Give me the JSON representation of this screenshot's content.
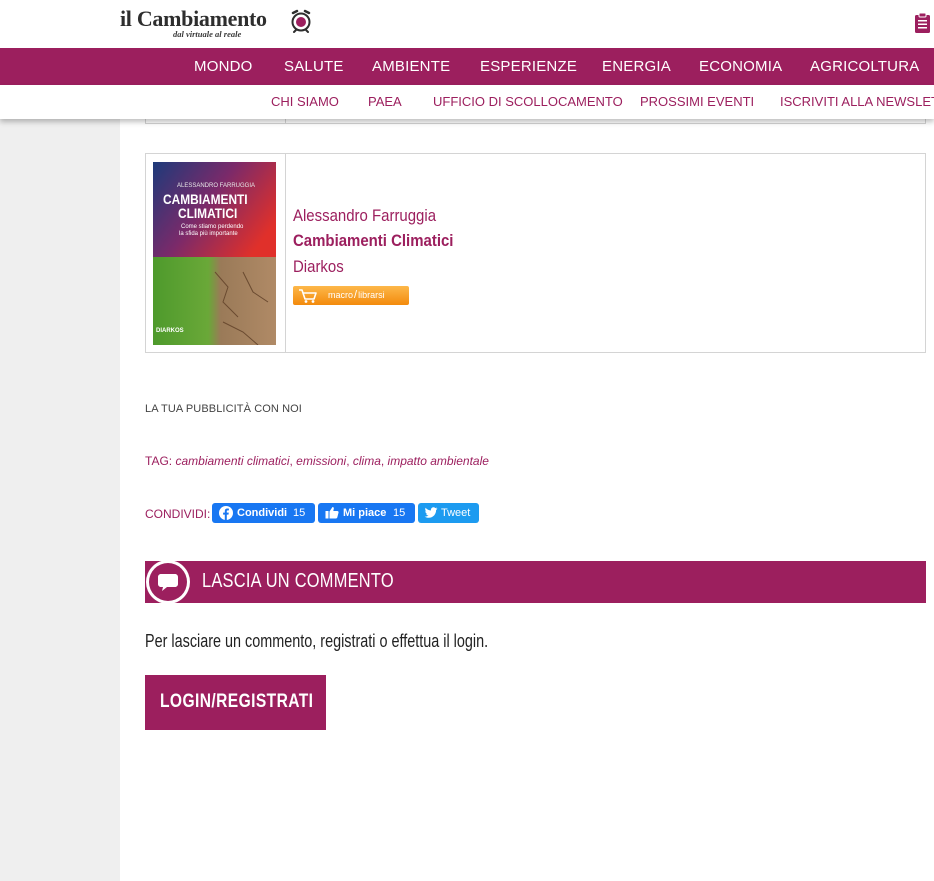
{
  "brand": {
    "name": "il Cambiamento",
    "tagline": "dal virtuale al reale"
  },
  "main_nav": [
    "MONDO",
    "SALUTE",
    "AMBIENTE",
    "ESPERIENZE",
    "ENERGIA",
    "ECONOMIA",
    "AGRICOLTURA"
  ],
  "sub_nav": [
    "CHI SIAMO",
    "PAEA",
    "UFFICIO DI SCOLLOCAMENTO",
    "PROSSIMI EVENTI",
    "ISCRIVITI ALLA NEWSLETT"
  ],
  "book": {
    "author": "Alessandro Farruggia",
    "title": "Cambiamenti Climatici",
    "publisher": "Diarkos",
    "cover": {
      "author": "ALESSANDRO FARRUGGIA",
      "title_line1": "CAMBIAMENTI",
      "title_line2": "CLIMATICI",
      "subtitle_line1": "Come stiamo perdendo",
      "subtitle_line2": "la sfida più importante",
      "publisher": "DIARKOS"
    },
    "buy_button": {
      "label_a": "macro",
      "label_b": "librarsi"
    }
  },
  "ad_text": "LA TUA PUBBLICITÀ CON NOI",
  "tags": {
    "label": "TAG:",
    "items": [
      "cambiamenti climatici",
      "emissioni",
      "clima",
      "impatto ambientale"
    ]
  },
  "share": {
    "label": "CONDIVIDI:",
    "fb_share_label": "Condividi",
    "fb_share_count": "15",
    "fb_like_label": "Mi piace",
    "fb_like_count": "15",
    "tweet_label": "Tweet"
  },
  "comments": {
    "title": "LASCIA UN COMMENTO",
    "login_prompt": "Per lasciare un commento, registrati o effettua il login.",
    "login_button": "LOGIN/REGISTRATI"
  },
  "colors": {
    "brand": "#9c1f5e",
    "facebook": "#1877f2",
    "twitter": "#1d9bf0",
    "buy_orange": "#f38a0c"
  }
}
